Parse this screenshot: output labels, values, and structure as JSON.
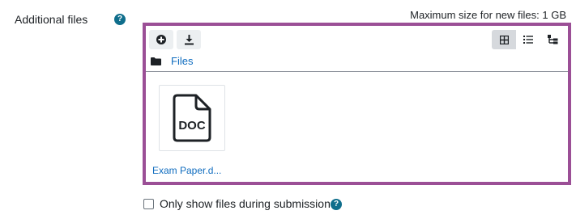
{
  "field": {
    "label": "Additional files",
    "help_glyph": "?",
    "max_size": "Maximum size for new files: 1 GB"
  },
  "filepicker": {
    "toolbar": {
      "add_icon": "plus-circle-icon",
      "download_icon": "download-icon"
    },
    "views": [
      {
        "icon": "grid-view-icon",
        "active": true
      },
      {
        "icon": "list-view-icon",
        "active": false
      },
      {
        "icon": "tree-view-icon",
        "active": false
      }
    ],
    "breadcrumb": {
      "label": "Files"
    },
    "files": [
      {
        "name": "Exam Paper.d...",
        "type_label": "DOC",
        "icon": "doc-file-icon"
      }
    ]
  },
  "submission_option": {
    "label": "Only show files during submission",
    "checked": false,
    "help_glyph": "?"
  },
  "colors": {
    "frame_border": "#9b4f96",
    "link": "#0f6cbf",
    "help_badge": "#0f6e8c"
  }
}
